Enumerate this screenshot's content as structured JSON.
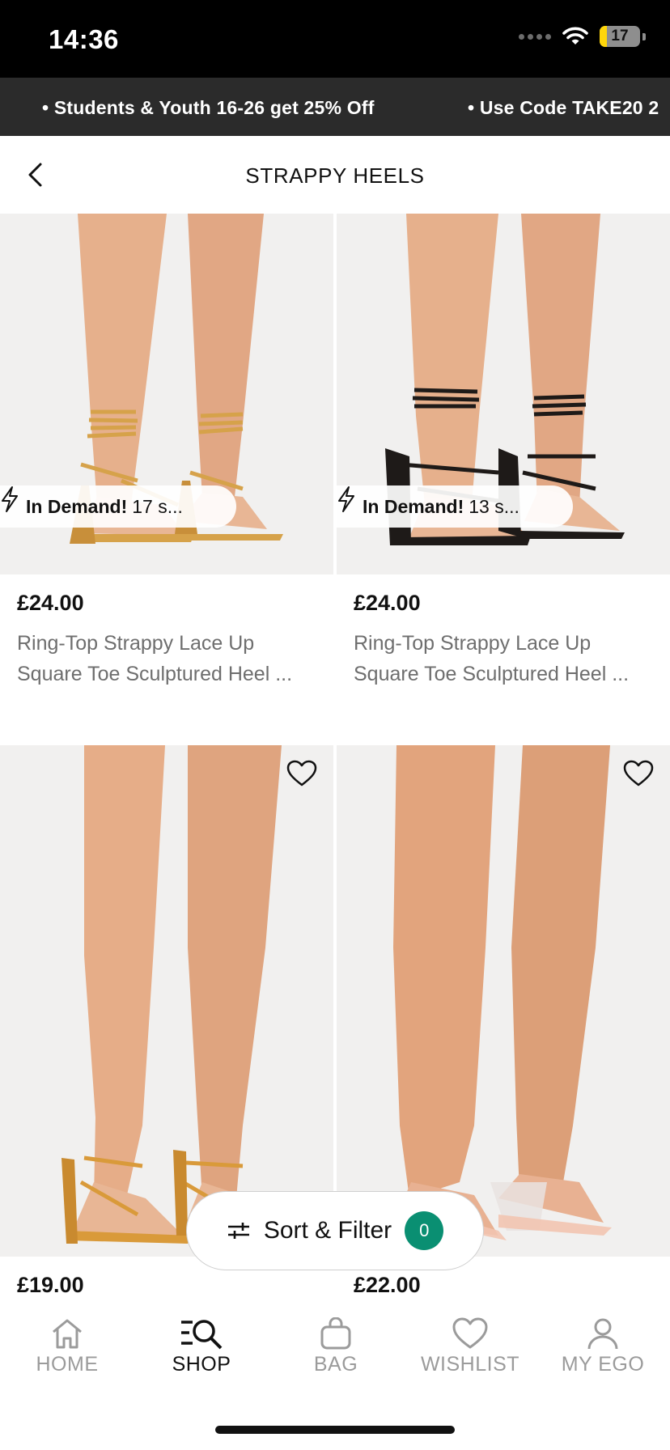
{
  "status_bar": {
    "time": "14:36",
    "battery_level": "17",
    "battery_fraction": 0.17
  },
  "promo": {
    "items": [
      "• Students & Youth 16-26 get 25% Off",
      "• Use Code TAKE20 2"
    ]
  },
  "header": {
    "title": "STRAPPY HEELS",
    "back_icon": "chevron-left-icon"
  },
  "products": [
    {
      "price": "£24.00",
      "name_line1": "Ring-Top Strappy Lace Up",
      "name_line2": "Square Toe Sculptured Heel ...",
      "demand_label": "In Demand!",
      "demand_text": "17 s...",
      "shoe_color": "#d6a24a"
    },
    {
      "price": "£24.00",
      "name_line1": "Ring-Top Strappy Lace Up",
      "name_line2": "Square Toe Sculptured Heel ...",
      "demand_label": "In Demand!",
      "demand_text": "13 s...",
      "shoe_color": "#1e1a18"
    },
    {
      "price": "£19.00",
      "shoe_color": "#d99a3a"
    },
    {
      "price": "£22.00",
      "shoe_color": "#f2c4b0"
    }
  ],
  "sort_filter": {
    "label": "Sort & Filter",
    "count": "0",
    "badge_color": "#0a8f72"
  },
  "tabbar": {
    "items": [
      {
        "label": "HOME",
        "icon": "home-icon"
      },
      {
        "label": "SHOP",
        "icon": "shop-search-icon",
        "active": true
      },
      {
        "label": "BAG",
        "icon": "bag-icon"
      },
      {
        "label": "WISHLIST",
        "icon": "heart-icon"
      },
      {
        "label": "MY EGO",
        "icon": "person-icon"
      }
    ]
  }
}
